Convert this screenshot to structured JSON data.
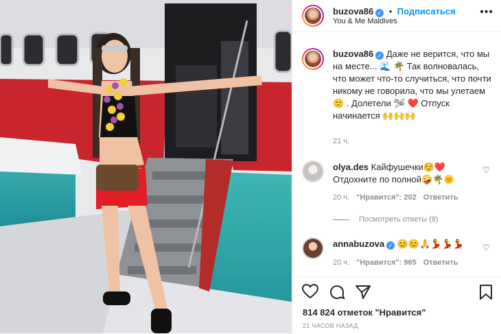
{
  "post": {
    "username": "buzova86",
    "follow_label": "Подписаться",
    "location": "You & Me Maldives",
    "menu_icon": "more-horizontal-icon"
  },
  "caption": {
    "username": "buzova86",
    "text": "Даже не верится, что мы на месте... 🌊 🌴 Так волновалась, что может что-то случиться, что почти никому не говорила, что мы улетаем 🙁 . Долетели 🛩 ❤️ Отпуск начинается 🙌🙌🙌",
    "time": "21 ч."
  },
  "comments": [
    {
      "username": "olya.des",
      "text": "Кайфушечки☺️❤️ Отдохните по полной🤪🌴🌞",
      "time": "20 ч.",
      "likes": "\"Нравится\": 202",
      "reply": "Ответить"
    },
    {
      "username": "annabuzova",
      "text": "😊😊🙏💃💃💃",
      "time": "20 ч.",
      "likes": "\"Нравится\": 965",
      "reply": "Ответить"
    }
  ],
  "view_replies": "Посмотреть ответы (8)",
  "likes": "814 824 отметок \"Нравится\"",
  "timestamp": "21 ЧАСОВ НАЗАД"
}
